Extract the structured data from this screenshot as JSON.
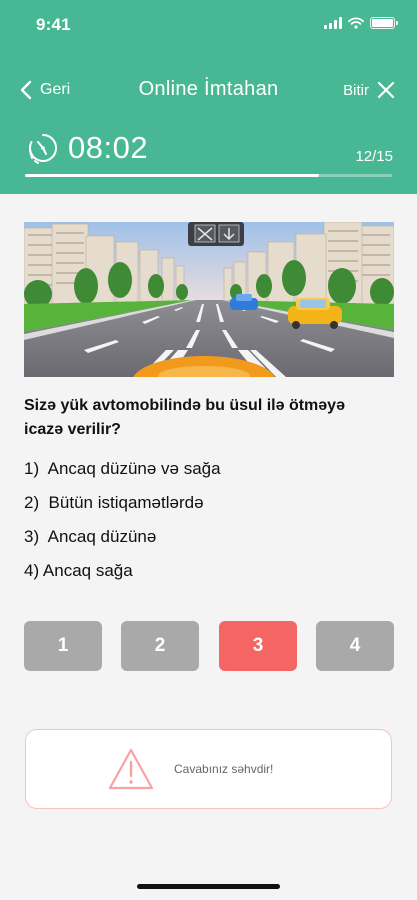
{
  "status_bar": {
    "time": "9:41"
  },
  "nav": {
    "back_label": "Geri",
    "title": "Online İmtahan",
    "finish_label": "Bitir"
  },
  "exam": {
    "timer": "08:02",
    "counter": "12/15",
    "progress": 0.8
  },
  "question": {
    "text": "Sizə yük avtomobilində bu üsul ilə ötməyə icazə verilir?",
    "options": [
      "1)  Ancaq düzünə və sağa",
      "2)  Bütün istiqamətlərdə",
      "3)  Ancaq düzünə",
      "4) Ancaq sağa"
    ]
  },
  "answers": {
    "buttons": [
      "1",
      "2",
      "3",
      "4"
    ],
    "selected_index": 2
  },
  "feedback": {
    "text": "Cavabınız səhvdir!"
  },
  "colors": {
    "header_bg": "#47b893",
    "answer_default": "#a9a9a9",
    "answer_wrong": "#f56563",
    "feedback_border": "#f7c2c2",
    "page_bg": "#f4f4f4"
  },
  "icons": {
    "back": "chevron-left-icon",
    "finish": "close-icon",
    "timer": "stopwatch-icon",
    "feedback": "warning-icon"
  }
}
